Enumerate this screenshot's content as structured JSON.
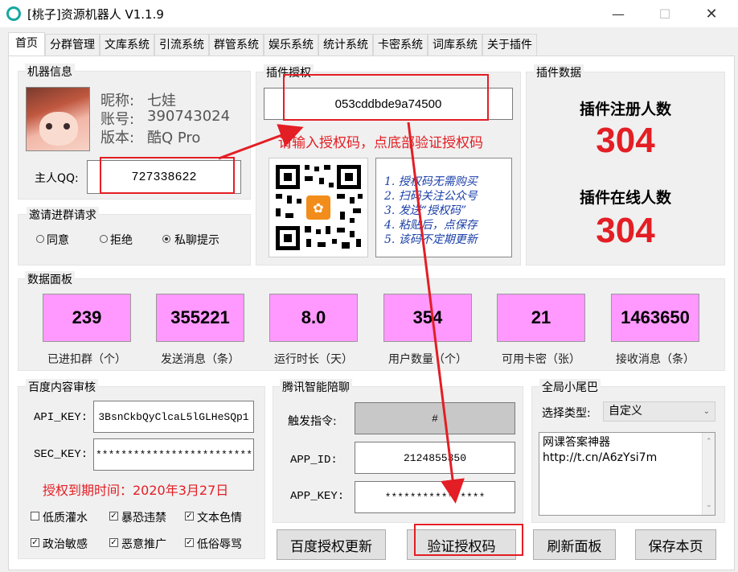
{
  "window": {
    "title": "[桃子]资源机器人 V1.1.9",
    "minimize": "—",
    "maximize": "☐",
    "close": "✕"
  },
  "tabs": [
    "首页",
    "分群管理",
    "文库系统",
    "引流系统",
    "群管系统",
    "娱乐系统",
    "统计系统",
    "卡密系统",
    "词库系统",
    "关于插件"
  ],
  "machine_info": {
    "title": "机器信息",
    "nickname_label": "昵称:",
    "nickname": "七娃",
    "account_label": "账号:",
    "account": "390743024",
    "version_label": "版本:",
    "version": "酷Q Pro",
    "owner_label": "主人QQ:",
    "owner_qq": "727338622"
  },
  "invite": {
    "title": "邀请进群请求",
    "options": [
      "同意",
      "拒绝",
      "私聊提示"
    ],
    "selected_index": 2
  },
  "license": {
    "title": "插件授权",
    "code": "053cddbde9a74500",
    "hint": "请输入授权码，点底部验证授权码",
    "steps": [
      "1. 授权码无需购买",
      "2. 扫码关注公众号",
      "3. 发送“授权码”",
      "4. 粘贴后，点保存",
      "5. 该码不定期更新"
    ]
  },
  "plugin_data": {
    "title": "插件数据",
    "registered_label": "插件注册人数",
    "registered": "304",
    "online_label": "插件在线人数",
    "online": "304"
  },
  "dashboard": {
    "title": "数据面板",
    "stats": [
      {
        "value": "239",
        "label": "已进扣群（个）"
      },
      {
        "value": "355221",
        "label": "发送消息（条）"
      },
      {
        "value": "8.0",
        "label": "运行时长（天）"
      },
      {
        "value": "354",
        "label": "用户数量（个）"
      },
      {
        "value": "21",
        "label": "可用卡密（张）"
      },
      {
        "value": "1463650",
        "label": "接收消息（条）"
      }
    ]
  },
  "baidu": {
    "title": "百度内容审核",
    "api_key_label": "API_KEY:",
    "api_key": "3BsnCkbQyClcaL5lGLHeSQp1",
    "sec_key_label": "SEC_KEY:",
    "sec_key": "****************************",
    "expire": "授权到期时间：2020年3月27日",
    "checks": [
      {
        "label": "低质灌水",
        "checked": false
      },
      {
        "label": "暴恐违禁",
        "checked": true
      },
      {
        "label": "文本色情",
        "checked": true
      },
      {
        "label": "政治敏感",
        "checked": true
      },
      {
        "label": "恶意推广",
        "checked": true
      },
      {
        "label": "低俗辱骂",
        "checked": true
      }
    ],
    "update_button": "百度授权更新"
  },
  "tencent": {
    "title": "腾讯智能陪聊",
    "trigger_label": "触发指令:",
    "trigger": "#",
    "app_id_label": "APP_ID:",
    "app_id": "2124855350",
    "app_key_label": "APP_KEY:",
    "app_key": "****************",
    "verify_button": "验证授权码"
  },
  "tail": {
    "title": "全局小尾巴",
    "type_label": "选择类型:",
    "type_value": "自定义",
    "text_line1": "网课答案神器",
    "text_line2": "http://t.cn/A6zYsi7m",
    "refresh_button": "刷新面板",
    "save_button": "保存本页"
  },
  "colors": {
    "accent_red": "#e31e24",
    "stat_pink": "#ff99ff",
    "icon_teal": "#16a7a0"
  }
}
